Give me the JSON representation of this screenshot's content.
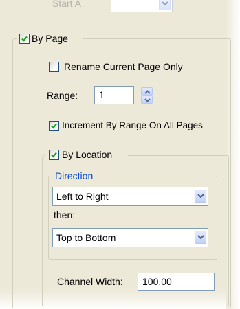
{
  "start_at": {
    "label_fragment": "Start A"
  },
  "by_page": {
    "label": "By Page",
    "checked": true
  },
  "rename_current_page_only": {
    "label": "Rename Current Page Only",
    "checked": false
  },
  "range": {
    "label": "Range:",
    "value": "1"
  },
  "increment_by_range": {
    "label": "Increment By Range On All Pages",
    "checked": true
  },
  "by_location": {
    "label": "By Location",
    "checked": true
  },
  "direction": {
    "legend": "Direction",
    "primary_value": "Left to Right",
    "then_label": "then:",
    "secondary_value": "Top to Bottom"
  },
  "channel_width": {
    "label_prefix": "Channel ",
    "label_accel": "W",
    "label_suffix": "idth:",
    "value": "100.00"
  },
  "colors": {
    "panel_bg": "#ece9d8",
    "checkmark": "#21a121",
    "group_legend": "#0046d5",
    "input_border": "#7f9db9"
  }
}
